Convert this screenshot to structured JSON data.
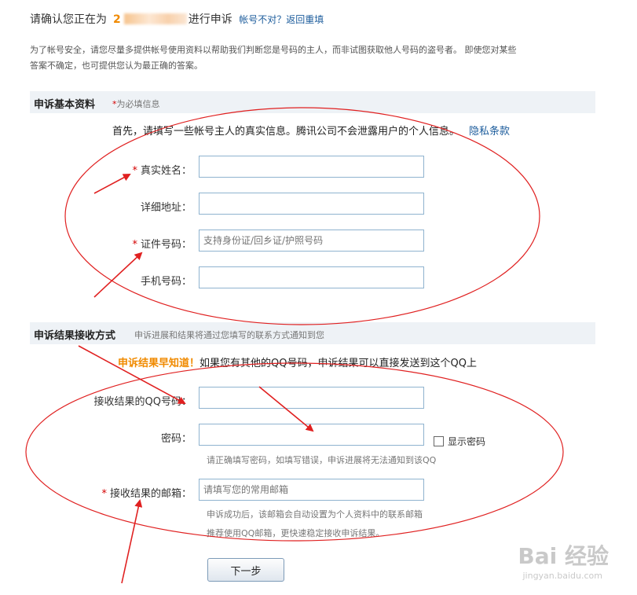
{
  "header": {
    "prefix": "请确认您正在为",
    "account_visible": "2",
    "suffix": "进行申诉",
    "link": "帐号不对？返回重填"
  },
  "intro": "为了帐号安全，请您尽量多提供帐号使用资料以帮助我们判断您是号码的主人，而非试图获取他人号码的盗号者。 即使您对某些答案不确定，也可提供您认为最正确的答案。",
  "section_basic": {
    "title": "申诉基本资料",
    "required_star": "*",
    "required_note": "为必填信息",
    "notice": "首先，请填写一些帐号主人的真实信息。腾讯公司不会泄露用户的个人信息。",
    "privacy_link": "隐私条款",
    "fields": [
      {
        "star": "*",
        "label": "真实姓名：",
        "placeholder": ""
      },
      {
        "star": "",
        "label": "详细地址：",
        "placeholder": ""
      },
      {
        "star": "*",
        "label": "证件号码：",
        "placeholder": "支持身份证/回乡证/护照号码"
      },
      {
        "star": "",
        "label": "手机号码：",
        "placeholder": ""
      }
    ]
  },
  "section_result": {
    "title": "申诉结果接收方式",
    "sub": "申诉进展和结果将通过您填写的联系方式通知到您",
    "notice_em": "申诉结果早知道！",
    "notice_rest": "如果您有其他的QQ号码，申诉结果可以直接发送到这个QQ上",
    "qq_label": "接收结果的QQ号码：",
    "password_label": "密码：",
    "show_password": "显示密码",
    "password_hint": "请正确填写密码，如填写错误，申诉进展将无法通知到该QQ",
    "email_star": "*",
    "email_label": "接收结果的邮箱：",
    "email_placeholder": "请填写您的常用邮箱",
    "email_hint1": "申诉成功后，该邮箱会自动设置为个人资料中的联系邮箱",
    "email_hint2": "推荐使用QQ邮箱，更快速稳定接收申诉结果。"
  },
  "next_button": "下一步",
  "watermark": "Bai  经验",
  "watermark_sub": "jingyan.baidu.com",
  "colors": {
    "accent_orange": "#f08a00",
    "link_blue": "#1c5c9c",
    "required_red": "#d40000",
    "annotation_red": "#e02020"
  }
}
